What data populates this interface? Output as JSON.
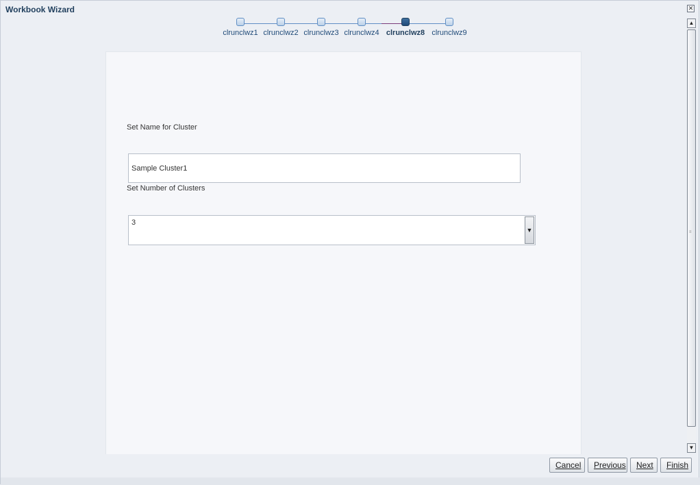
{
  "window": {
    "title": "Workbook Wizard",
    "close_icon": "close-icon"
  },
  "train": {
    "steps": [
      {
        "label": "clrunclwz1"
      },
      {
        "label": "clrunclwz2"
      },
      {
        "label": "clrunclwz3"
      },
      {
        "label": "clrunclwz4"
      },
      {
        "label": "clrunclwz8"
      },
      {
        "label": "clrunclwz9"
      }
    ],
    "current_index": 4
  },
  "form": {
    "name_label": "Set Name for Cluster",
    "name_value": "Sample Cluster1",
    "number_label": "Set Number of Clusters",
    "number_value": "3"
  },
  "buttons": {
    "cancel": "Cancel",
    "previous": "Previous",
    "next": "Next",
    "finish": "Finish"
  },
  "colors": {
    "accent": "#1f3e5c",
    "train_line": "#5f8ec4",
    "current_segment": "#7a3b7a"
  }
}
